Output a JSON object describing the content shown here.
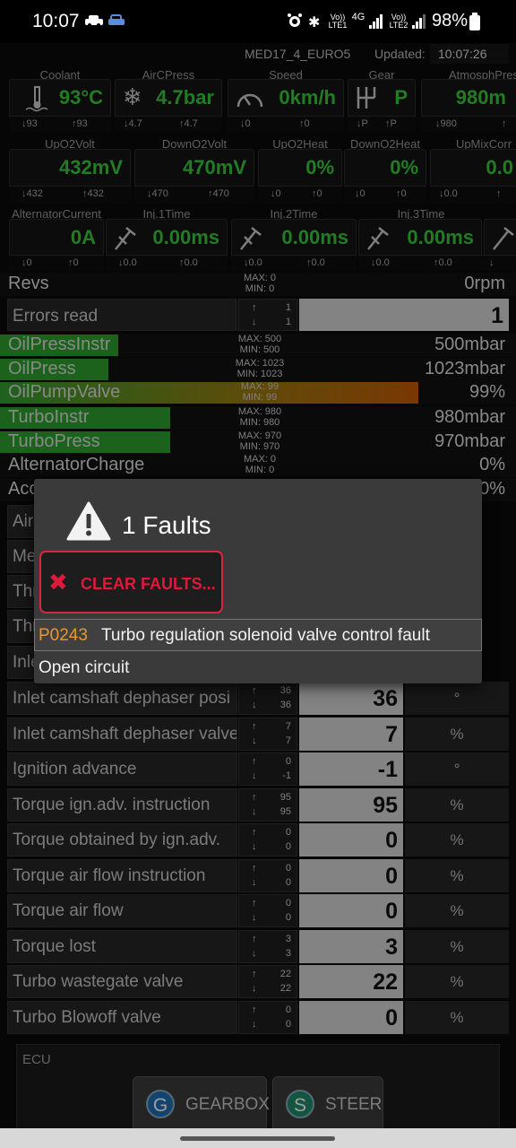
{
  "status": {
    "time": "10:07",
    "battery": "98%",
    "sim1": "Vo)) LTE1",
    "net": "4G",
    "sim2": "Vo)) LTE2"
  },
  "header": {
    "ecu": "MED17_4_EURO5",
    "updated_label": "Updated:",
    "updated_value": "10:07:26"
  },
  "gauges_row1": [
    {
      "label": "Coolant",
      "value": "93°C",
      "min": "93",
      "max": "93",
      "icon": "thermometer-icon"
    },
    {
      "label": "AirCPress",
      "value": "4.7bar",
      "min": "4.7",
      "max": "4.7",
      "icon": "snowflake-icon"
    },
    {
      "label": "Speed",
      "value": "0km/h",
      "min": "0",
      "max": "0",
      "icon": "speedometer-icon"
    },
    {
      "label": "Gear",
      "value": "P",
      "min": "P",
      "max": "P",
      "icon": "gearshift-icon"
    },
    {
      "label": "AtmosphPres",
      "value": "980m",
      "min": "980",
      "max": "",
      "icon": ""
    }
  ],
  "gauges_row2": [
    {
      "label": "UpO2Volt",
      "value": "432mV",
      "min": "432",
      "max": "432"
    },
    {
      "label": "DownO2Volt",
      "value": "470mV",
      "min": "470",
      "max": "470"
    },
    {
      "label": "UpO2Heat",
      "value": "0%",
      "min": "0",
      "max": "0"
    },
    {
      "label": "DownO2Heat",
      "value": "0%",
      "min": "0",
      "max": "0"
    },
    {
      "label": "UpMixCorr",
      "value": "0.0",
      "min": "0.0",
      "max": ""
    }
  ],
  "gauges_row3": [
    {
      "label": "AlternatorCurrent",
      "value": "0A",
      "min": "0",
      "max": "0"
    },
    {
      "label": "Inj.1Time",
      "value": "0.00ms",
      "min": "0.0",
      "max": "0.0",
      "icon": "injector-icon"
    },
    {
      "label": "Inj.2Time",
      "value": "0.00ms",
      "min": "0.0",
      "max": "0.0",
      "icon": "injector-icon"
    },
    {
      "label": "Inj.3Time",
      "value": "0.00ms",
      "min": "0.0",
      "max": "0.0",
      "icon": "injector-icon"
    }
  ],
  "revs": {
    "name": "Revs",
    "max": "MAX: 0",
    "min": "MIN: 0",
    "value": "0rpm"
  },
  "errors": {
    "name": "Errors read",
    "up": "1",
    "down": "1",
    "value": "1"
  },
  "bar_rows": [
    {
      "name": "OilPressInstr",
      "max": "MAX: 500",
      "min": "MIN: 500",
      "value": "500mbar",
      "fill": 0.23,
      "color": "#2e9f2e"
    },
    {
      "name": "OilPress",
      "max": "MAX: 1023",
      "min": "MIN: 1023",
      "value": "1023mbar",
      "fill": 0.21,
      "color": "#2e9f2e"
    },
    {
      "name": "OilPumpValve",
      "max": "MAX: 99",
      "min": "MIN: 99",
      "value": "99%",
      "fill": 0.81,
      "color": "gradient"
    },
    {
      "name": "TurboInstr",
      "max": "MAX: 980",
      "min": "MIN: 980",
      "value": "980mbar",
      "fill": 0.33,
      "color": "#2e9f2e"
    },
    {
      "name": "TurboPress",
      "max": "MAX: 970",
      "min": "MIN: 970",
      "value": "970mbar",
      "fill": 0.33,
      "color": "#2e9f2e"
    },
    {
      "name": "AlternatorCharge",
      "max": "MAX: 0",
      "min": "MIN: 0",
      "value": "0%",
      "fill": 0,
      "color": "#2e9f2e"
    },
    {
      "name": "Acc",
      "max": "",
      "min": "",
      "value": "0%",
      "fill": 0,
      "color": "#2e9f2e"
    }
  ],
  "hidden_rows": [
    {
      "name": "Air"
    },
    {
      "name": "Me"
    },
    {
      "name": "Thr"
    },
    {
      "name": "Thr"
    },
    {
      "name": "Inle"
    }
  ],
  "table_rows": [
    {
      "name": "Inlet camshaft dephaser posi",
      "up": "36",
      "down": "36",
      "value": "36",
      "unit": "°"
    },
    {
      "name": "Inlet camshaft dephaser valve",
      "up": "7",
      "down": "7",
      "value": "7",
      "unit": "%"
    },
    {
      "name": "Ignition advance",
      "up": "0",
      "down": "-1",
      "value": "-1",
      "unit": "°"
    },
    {
      "name": "Torque ign.adv. instruction",
      "up": "95",
      "down": "95",
      "value": "95",
      "unit": "%"
    },
    {
      "name": "Torque obtained by ign.adv.",
      "up": "0",
      "down": "0",
      "value": "0",
      "unit": "%"
    },
    {
      "name": "Torque air flow instruction",
      "up": "0",
      "down": "0",
      "value": "0",
      "unit": "%"
    },
    {
      "name": "Torque air flow",
      "up": "0",
      "down": "0",
      "value": "0",
      "unit": "%"
    },
    {
      "name": "Torque lost",
      "up": "3",
      "down": "3",
      "value": "3",
      "unit": "%"
    },
    {
      "name": "Turbo wastegate valve",
      "up": "22",
      "down": "22",
      "value": "22",
      "unit": "%"
    },
    {
      "name": "Turbo Blowoff valve",
      "up": "0",
      "down": "0",
      "value": "0",
      "unit": "%"
    }
  ],
  "ecu_panel": {
    "label": "ECU",
    "buttons": [
      {
        "letter": "G",
        "label": "GEARBOX",
        "color": "#1f6fb5"
      },
      {
        "letter": "S",
        "label": "STEER",
        "color": "#1f8a6a"
      }
    ]
  },
  "dialog": {
    "title": "1 Faults",
    "clear_label": "CLEAR FAULTS...",
    "fault_code": "P0243",
    "fault_desc": "Turbo regulation solenoid valve control fault",
    "fault_sub": "Open circuit"
  }
}
